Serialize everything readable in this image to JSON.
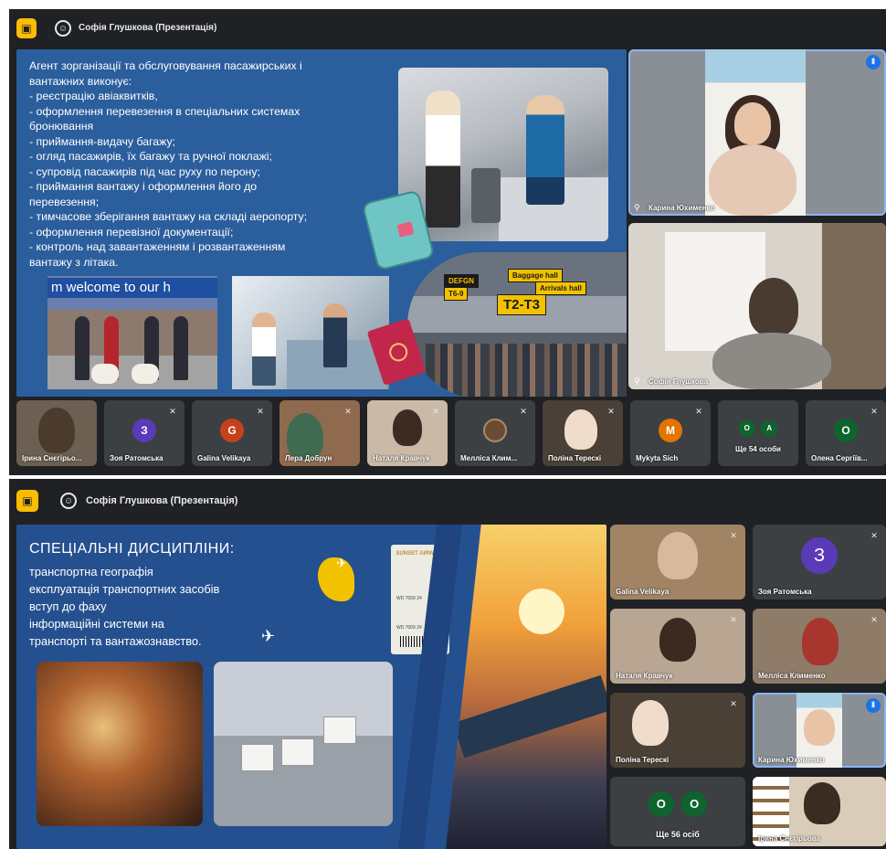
{
  "shot1": {
    "presenter": "Софія Глушкова (Презентація)",
    "slide": {
      "lines": [
        "Агент зорганізації та обслуговування пасажирських і",
        "вантажних виконує:",
        "- реєстрацію авіаквитків,",
        "- оформлення перевезення в спеціальних системах",
        "бронювання",
        "- приймання-видачу багажу;",
        "- огляд пасажирів, їх багажу та ручної поклажі;",
        "- супровід пасажирів під час руху по перону;",
        "- приймання вантажу і оформлення його до",
        "перевезення;",
        "- тимчасове зберігання вантажу на складі аеропорту;",
        "- оформлення перевізної документації;",
        "- контроль над завантаженням і розвантаженням",
        "вантажу з літака."
      ],
      "welcome_banner": "m welcome to our h",
      "signs": {
        "defgn": "DEFGN",
        "t69": "T6-9",
        "t2t3": "T2-T3",
        "baggage": "Baggage hall",
        "arrivals": "Arrivals hall"
      }
    },
    "side_tiles": [
      {
        "name": "Карина Юхименко"
      },
      {
        "name": "Софія Глушкова"
      }
    ],
    "bottom_tiles": [
      {
        "name": "Ірина Снєгірьо...",
        "avatar": ""
      },
      {
        "name": "Зоя Ратомська",
        "avatar": "З"
      },
      {
        "name": "Galina Velikaya",
        "avatar": "G"
      },
      {
        "name": "Лера Добрун",
        "avatar": ""
      },
      {
        "name": "Наталя Кравчук",
        "avatar": ""
      },
      {
        "name": "Мелліса Клим...",
        "avatar": ""
      },
      {
        "name": "Поліна Терескі",
        "avatar": ""
      },
      {
        "name": "Mykyta Sich",
        "avatar": "M"
      },
      {
        "name": "Ще 54 особи",
        "avatar": "",
        "minis": [
          "O",
          "A"
        ]
      },
      {
        "name": "Олена Сергіїв...",
        "avatar": "О"
      }
    ],
    "colors": {
      "z": "#5b3ab8",
      "g": "#c5411d",
      "m": "#e37400",
      "o": "#0d652d"
    }
  },
  "shot2": {
    "presenter": "Софія Глушкова (Презентація)",
    "slide": {
      "title": "СПЕЦІАЛЬНІ ДИСЦИПЛІНИ:",
      "items": [
        "транспортна географія",
        "експлуатація транспортних засобів",
        "вступ до фаху",
        "інформаційні системи на",
        "транспорті та вантажознавство."
      ],
      "ticket": {
        "brand": "SUNSET AIRWAYS",
        "flight": "WD 7009 24"
      }
    },
    "tiles": [
      {
        "name": "Galina Velikaya"
      },
      {
        "name": "Зоя Ратомська",
        "avatar": "З"
      },
      {
        "name": "Наталя Кравчук"
      },
      {
        "name": "Мелліса Клименко"
      },
      {
        "name": "Поліна Терескі"
      },
      {
        "name": "Карина Юхименко"
      },
      {
        "name": "Ще 56 осіб",
        "minis": [
          "O",
          "O"
        ]
      },
      {
        "name": "Ірина Снєгірьова"
      }
    ]
  },
  "icons": {
    "present": "present-screen-icon",
    "presenter": "presenter-avatar-icon",
    "mic_off": "mic-off-icon",
    "speaking": "speaking-indicator-icon",
    "pin": "pin-icon"
  }
}
